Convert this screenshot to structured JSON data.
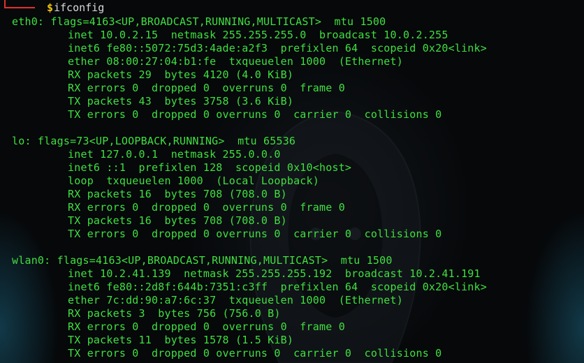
{
  "prompt": {
    "symbol": "$",
    "command": "ifconfig"
  },
  "interfaces": [
    {
      "header": "eth0: flags=4163<UP,BROADCAST,RUNNING,MULTICAST>  mtu 1500",
      "lines": [
        "inet 10.0.2.15  netmask 255.255.255.0  broadcast 10.0.2.255",
        "inet6 fe80::5072:75d3:4ade:a2f3  prefixlen 64  scopeid 0x20<link>",
        "ether 08:00:27:04:b1:fe  txqueuelen 1000  (Ethernet)",
        "RX packets 29  bytes 4120 (4.0 KiB)",
        "RX errors 0  dropped 0  overruns 0  frame 0",
        "TX packets 43  bytes 3758 (3.6 KiB)",
        "TX errors 0  dropped 0 overruns 0  carrier 0  collisions 0"
      ]
    },
    {
      "header": "lo: flags=73<UP,LOOPBACK,RUNNING>  mtu 65536",
      "lines": [
        "inet 127.0.0.1  netmask 255.0.0.0",
        "inet6 ::1  prefixlen 128  scopeid 0x10<host>",
        "loop  txqueuelen 1000  (Local Loopback)",
        "RX packets 16  bytes 708 (708.0 B)",
        "RX errors 0  dropped 0  overruns 0  frame 0",
        "TX packets 16  bytes 708 (708.0 B)",
        "TX errors 0  dropped 0 overruns 0  carrier 0  collisions 0"
      ]
    },
    {
      "header": "wlan0: flags=4163<UP,BROADCAST,RUNNING,MULTICAST>  mtu 1500",
      "lines": [
        "inet 10.2.41.139  netmask 255.255.255.192  broadcast 10.2.41.191",
        "inet6 fe80::2d8f:644b:7351:c3ff  prefixlen 64  scopeid 0x20<link>",
        "ether 7c:dd:90:a7:6c:37  txqueuelen 1000  (Ethernet)",
        "RX packets 3  bytes 756 (756.0 B)",
        "RX errors 0  dropped 0  overruns 0  frame 0",
        "TX packets 11  bytes 1578 (1.5 KiB)",
        "TX errors 0  dropped 0 overruns 0  carrier 0  collisions 0"
      ]
    }
  ],
  "colors": {
    "text": "#3fe03f",
    "prompt_symbol": "#f1c40f",
    "prompt_corner": "#e0312c",
    "command": "#d9d9d9",
    "background": "#06080a"
  }
}
